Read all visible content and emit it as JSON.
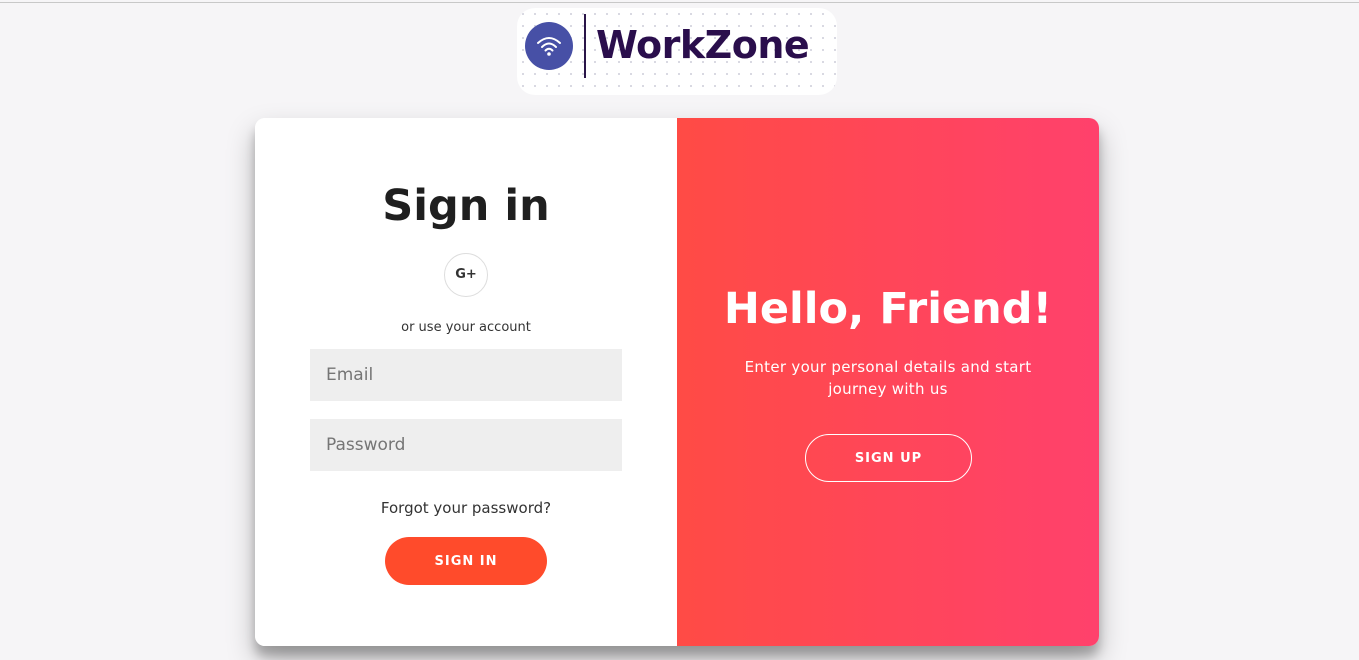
{
  "logo": {
    "brand_name": "WorkZone",
    "icon": "wifi-icon"
  },
  "signin": {
    "title": "Sign in",
    "social_button_label": "G+",
    "social_icon": "google-plus-icon",
    "alt_text": "or use your account",
    "email_placeholder": "Email",
    "email_value": "",
    "password_placeholder": "Password",
    "password_value": "",
    "forgot_password": "Forgot your password?",
    "submit_label": "SIGN IN"
  },
  "overlay": {
    "title": "Hello, Friend!",
    "text": "Enter your personal details and start journey with us",
    "signup_label": "SIGN UP"
  },
  "colors": {
    "page_bg": "#f6f5f7",
    "accent": "#ff4b2b",
    "gradient_start": "#ff4b45",
    "gradient_end": "#ff416c",
    "logo_circle": "#4750a6",
    "brand_text": "#2a0e4c"
  }
}
